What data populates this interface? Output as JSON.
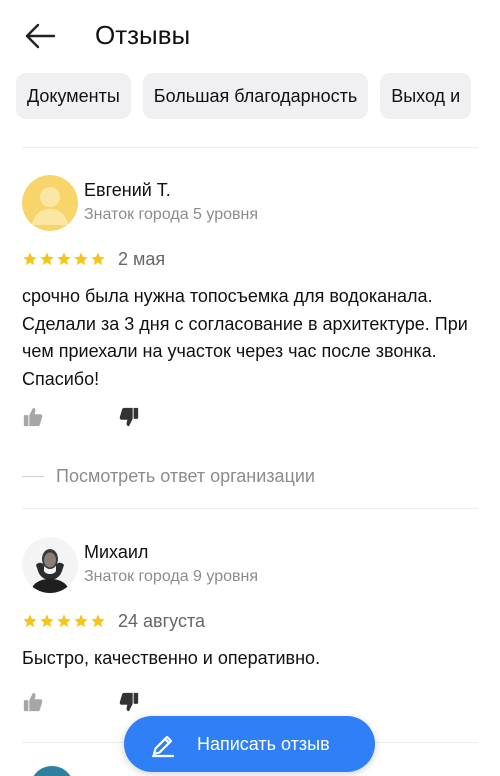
{
  "header": {
    "back_icon": "arrow-left-icon",
    "title": "Отзывы"
  },
  "chips": [
    {
      "label": "Документы"
    },
    {
      "label": "Большая благодарность"
    },
    {
      "label": "Выход и"
    }
  ],
  "reviews": [
    {
      "author": "Евгений Т.",
      "level": "Знаток города 5 уровня",
      "rating": 5,
      "date": "2 мая",
      "text": "срочно была нужна топосъемка для водоканала. Сделали за 3 дня с согласование в архитектуре. При чем приехали на участок через час после звонка. Спасибо!",
      "org_reply_label": "Посмотреть ответ организации"
    },
    {
      "author": "Михаил",
      "level": "Знаток города 9 уровня",
      "rating": 5,
      "date": "24 августа",
      "text": "Быстро, качественно и оперативно."
    }
  ],
  "write_review": {
    "label": "Написать отзыв",
    "icon": "pencil-icon"
  },
  "colors": {
    "accent": "#2f80f6",
    "star": "#f5c518",
    "chip_bg": "#f0f0f2",
    "secondary_text": "#8c8c8c"
  }
}
